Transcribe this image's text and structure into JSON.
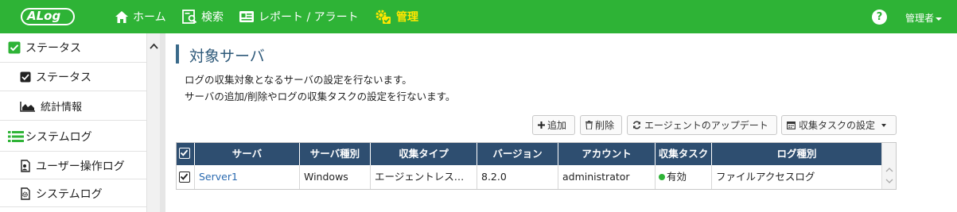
{
  "topbar": {
    "logo": "ALog",
    "nav": [
      {
        "label": "ホーム",
        "icon": "home-icon"
      },
      {
        "label": "検索",
        "icon": "search-doc-icon"
      },
      {
        "label": "レポート / アラート",
        "icon": "report-icon"
      },
      {
        "label": "管理",
        "icon": "gear-icon",
        "active": true
      }
    ],
    "help": "?",
    "user": "管理者"
  },
  "sidebar": {
    "items": [
      {
        "label": "ステータス",
        "icon": "check-square-icon",
        "level": 1
      },
      {
        "label": "ステータス",
        "icon": "check-square-icon",
        "level": 2
      },
      {
        "label": "統計情報",
        "icon": "area-chart-icon",
        "level": 2
      },
      {
        "label": "システムログ",
        "icon": "list-icon",
        "level": 1
      },
      {
        "label": "ユーザー操作ログ",
        "icon": "user-doc-icon",
        "level": 2
      },
      {
        "label": "システムログ",
        "icon": "system-doc-icon",
        "level": 2
      }
    ]
  },
  "main": {
    "title": "対象サーバ",
    "desc1": "ログの収集対象となるサーバの設定を行ないます。",
    "desc2": "サーバの追加/削除やログの収集タスクの設定を行ないます。",
    "buttons": {
      "add": "追加",
      "delete": "削除",
      "agent_update": "エージェントのアップデート",
      "collect_task": "収集タスクの設定"
    },
    "table": {
      "headers": [
        "サーバ",
        "サーバ種別",
        "収集タイプ",
        "バージョン",
        "アカウント",
        "収集タスク",
        "ログ種別"
      ],
      "rows": [
        {
          "server": "Server1",
          "type": "Windows",
          "collect_type": "エージェントレス…",
          "version": "8.2.0",
          "account": "administrator",
          "task": "有効",
          "log_type": "ファイルアクセスログ"
        }
      ]
    }
  },
  "colors": {
    "brand": "#2eb336",
    "active_nav": "#ffe600",
    "table_header": "#2e4e70",
    "title": "#2f5a7a"
  }
}
